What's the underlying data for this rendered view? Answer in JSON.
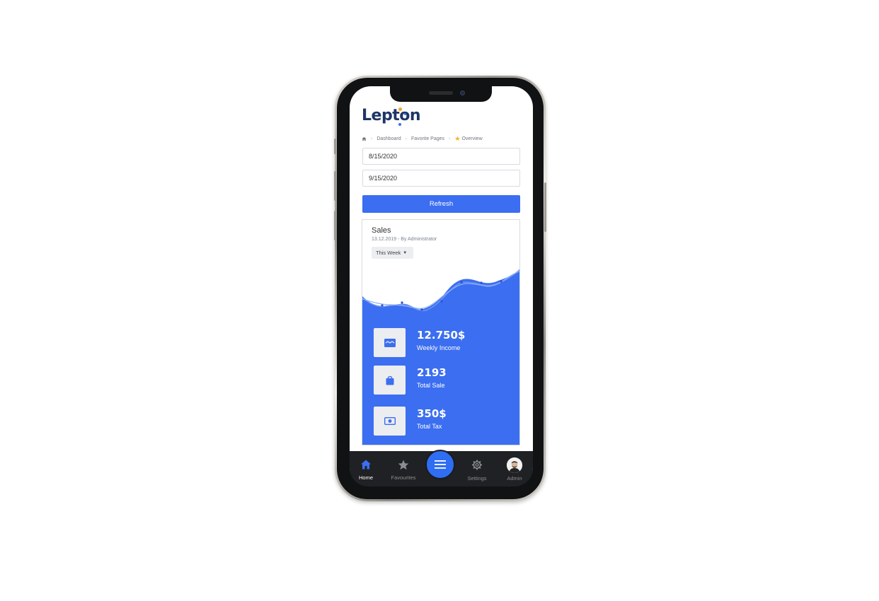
{
  "app": {
    "logo_text": "Lepton"
  },
  "breadcrumb": {
    "items": [
      "Dashboard",
      "Favorite Pages",
      "Overview"
    ]
  },
  "filters": {
    "start_date": "8/15/2020",
    "end_date": "9/15/2020",
    "refresh_label": "Refresh"
  },
  "sales_card": {
    "title": "Sales",
    "subtitle": "13.12.2019 - By Administrator",
    "period_label": "This Week",
    "stats": [
      {
        "value": "12.750$",
        "label": "Weekly Income",
        "icon": "wallet-icon"
      },
      {
        "value": "2193",
        "label": "Total Sale",
        "icon": "shopping-bag-icon"
      },
      {
        "value": "350$",
        "label": "Total Tax",
        "icon": "money-icon"
      }
    ]
  },
  "bottom_nav": {
    "items": [
      {
        "label": "Home",
        "icon": "home-icon",
        "active": true
      },
      {
        "label": "Favourites",
        "icon": "star-icon",
        "active": false
      },
      {
        "label": "Settings",
        "icon": "gear-icon",
        "active": false
      },
      {
        "label": "Admin",
        "icon": "avatar",
        "active": false
      }
    ],
    "center_icon": "menu-icon"
  },
  "colors": {
    "accent": "#3b6ef0",
    "logo": "#1e3566",
    "logo_dot_orange": "#f5a623",
    "logo_dot_blue": "#3b6ef0",
    "nav_background": "#202124"
  }
}
